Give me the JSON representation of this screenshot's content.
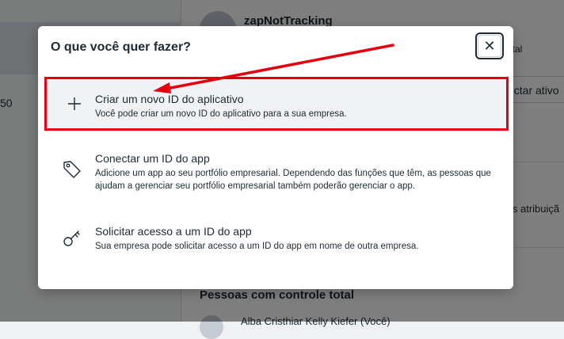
{
  "background": {
    "left_number": "50",
    "profile_name": "zapNotTracking",
    "partial_text_1": "ital",
    "button_partial": "ectar ativo",
    "partial_text_2": "is atribuiçã",
    "section_title": "Pessoas com controle total",
    "person_partial": "Alba Cristhiar Kelly Kiefer (Você)"
  },
  "dialog": {
    "title": "O que você quer fazer?",
    "close_label": "✕",
    "options": [
      {
        "title": "Criar um novo ID do aplicativo",
        "description": "Você pode criar um novo ID do aplicativo para a sua empresa.",
        "icon": "plus-icon"
      },
      {
        "title": "Conectar um ID do app",
        "description": "Adicione um app ao seu portfólio empresarial. Dependendo das funções que têm, as pessoas que ajudam a gerenciar seu portfólio empresarial também poderão gerenciar o app.",
        "icon": "tag-icon"
      },
      {
        "title": "Solicitar acesso a um ID do app",
        "description": "Sua empresa pode solicitar acesso a um ID do app em nome de outra empresa.",
        "icon": "key-icon"
      }
    ]
  },
  "colors": {
    "annotation_red": "#e4000f",
    "text": "#1c2b33",
    "highlight_bg": "#f1f2f3"
  }
}
